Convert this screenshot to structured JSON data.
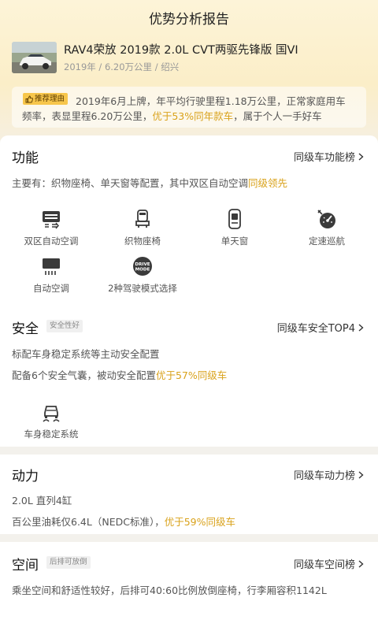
{
  "header": {
    "title": "优势分析报告"
  },
  "car": {
    "title": "RAV4荣放 2019款 2.0L CVT两驱先锋版 国VI",
    "meta": "2019年 / 6.20万公里 / 绍兴"
  },
  "reason": {
    "badge": "推荐理由",
    "line1": "2019年6月上牌，年平均行驶里程1.18万公里，正常家庭用车",
    "line2_a": "频率，表显里程6.20万公里，",
    "line2_hl": "优于53%同年款车",
    "line2_b": "，属于个人一手好车"
  },
  "function": {
    "title": "功能",
    "link": "同级车功能榜",
    "desc_a": "主要有：织物座椅、单天窗等配置，其中双区自动空调",
    "desc_hl": "同级领先",
    "features": [
      {
        "label": "双区自动空调",
        "icon": "dual-zone-ac-icon"
      },
      {
        "label": "织物座椅",
        "icon": "seat-icon"
      },
      {
        "label": "单天窗",
        "icon": "sunroof-icon"
      },
      {
        "label": "定速巡航",
        "icon": "cruise-control-icon"
      },
      {
        "label": "自动空调",
        "icon": "auto-ac-icon"
      },
      {
        "label": "2种驾驶模式选择",
        "icon": "drive-mode-icon"
      }
    ],
    "drive_mode_text": "DRIVE MODE"
  },
  "safety": {
    "title": "安全",
    "tag": "安全性好",
    "link": "同级车安全TOP4",
    "line1": "标配车身稳定系统等主动安全配置",
    "line2_a": "配备6个安全气囊，被动安全配置",
    "line2_hl": "优于57%同级车",
    "features": [
      {
        "label": "车身稳定系统",
        "icon": "stability-control-icon"
      }
    ]
  },
  "power": {
    "title": "动力",
    "link": "同级车动力榜",
    "line1": "2.0L 直列4缸",
    "line2_a": "百公里油耗仅6.4L（NEDC标准），",
    "line2_hl": "优于59%同级车"
  },
  "space": {
    "title": "空间",
    "tag": "后排可放倒",
    "link": "同级车空间榜",
    "line1": "乘坐空间和舒适性较好，后排可40:60比例放倒座椅，行李厢容积1142L"
  },
  "colors": {
    "accent": "#d9a21b",
    "badge": "#f7c64b"
  }
}
